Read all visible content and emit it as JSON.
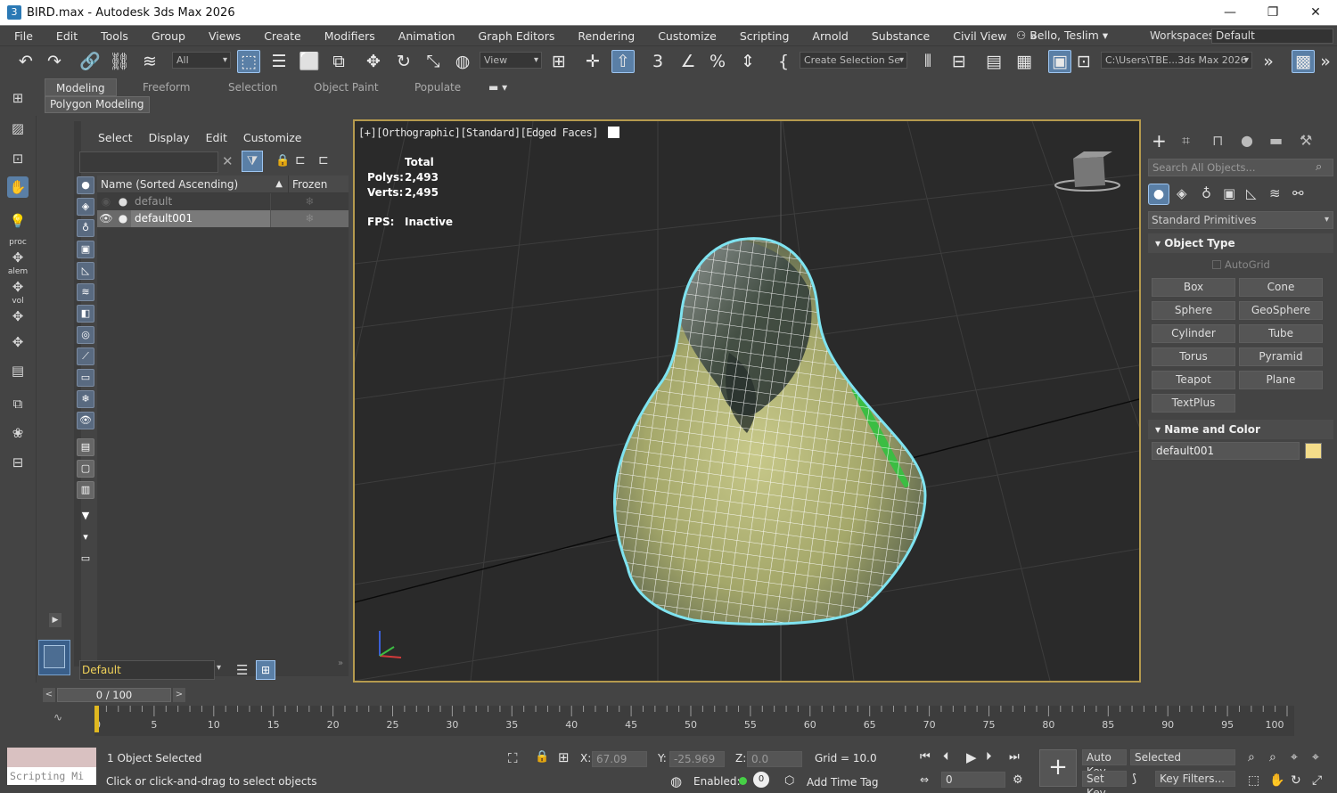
{
  "titlebar": {
    "title": "BIRD.max - Autodesk 3ds Max 2026",
    "minimize": "—",
    "restore": "❐",
    "close": "✕"
  },
  "menu": {
    "items": [
      "File",
      "Edit",
      "Tools",
      "Group",
      "Views",
      "Create",
      "Modifiers",
      "Animation",
      "Graph Editors",
      "Rendering",
      "Customize",
      "Scripting",
      "Arnold",
      "Substance",
      "Civil View",
      "»"
    ],
    "user": "Bello, Teslim",
    "workspaces_label": "Workspaces:",
    "workspace_value": "Default"
  },
  "toolbar": {
    "selection_filter": "All",
    "ref_coord": "View",
    "named_selection": "Create Selection Se",
    "project_path": "C:\\Users\\TBE...3ds Max 2026",
    "overflow": "»"
  },
  "ribbon": {
    "tabs": [
      "Modeling",
      "Freeform",
      "Selection",
      "Object Paint",
      "Populate"
    ],
    "subpanel": "Polygon Modeling"
  },
  "left_col": {
    "proc": "proc",
    "alem": "alem",
    "vol": "vol"
  },
  "explorer": {
    "menu": [
      "Select",
      "Display",
      "Edit",
      "Customize"
    ],
    "col_name": "Name (Sorted Ascending)",
    "col_sort": "▲",
    "col_frozen": "Frozen",
    "rows": [
      {
        "name": "default",
        "selected": false
      },
      {
        "name": "default001",
        "selected": true
      }
    ],
    "layer": "Default"
  },
  "viewport": {
    "label": "[+][Orthographic][Standard][Edged Faces]",
    "total_label": "Total",
    "polys_label": "Polys:",
    "polys": "2,493",
    "verts_label": "Verts:",
    "verts": "2,495",
    "fps_label": "FPS:",
    "fps": "Inactive"
  },
  "cmd": {
    "search_placeholder": "Search All Objects...",
    "category": "Standard Primitives",
    "object_type": "Object Type",
    "autogrid": "AutoGrid",
    "buttons": [
      "Box",
      "Cone",
      "Sphere",
      "GeoSphere",
      "Cylinder",
      "Tube",
      "Torus",
      "Pyramid",
      "Teapot",
      "Plane",
      "TextPlus"
    ],
    "name_color": "Name and Color",
    "object_name": "default001",
    "object_color": "#f4dd8a"
  },
  "timeline": {
    "frame": "0 / 100",
    "ticks": [
      "0",
      "5",
      "10",
      "15",
      "20",
      "25",
      "30",
      "35",
      "40",
      "45",
      "50",
      "55",
      "60",
      "65",
      "70",
      "75",
      "80",
      "85",
      "90",
      "95",
      "100"
    ]
  },
  "status": {
    "script_listener": "Scripting Mi",
    "selected": "1 Object Selected",
    "prompt": "Click or click-and-drag to select objects",
    "x_label": "X:",
    "x": "67.09",
    "y_label": "Y:",
    "y": "-25.969",
    "z_label": "Z:",
    "z": "0.0",
    "grid": "Grid = 10.0",
    "enabled": "Enabled:",
    "add_time_tag": "Add Time Tag",
    "auto_key": "Auto Key",
    "set_key": "Set Key",
    "key_mode": "Selected",
    "key_filters": "Key Filters...",
    "current_frame": "0"
  },
  "colors": {
    "viewport_border": "#b59a4e",
    "selection_outline": "#7fe3f0",
    "accent": "#5a7fa6"
  }
}
